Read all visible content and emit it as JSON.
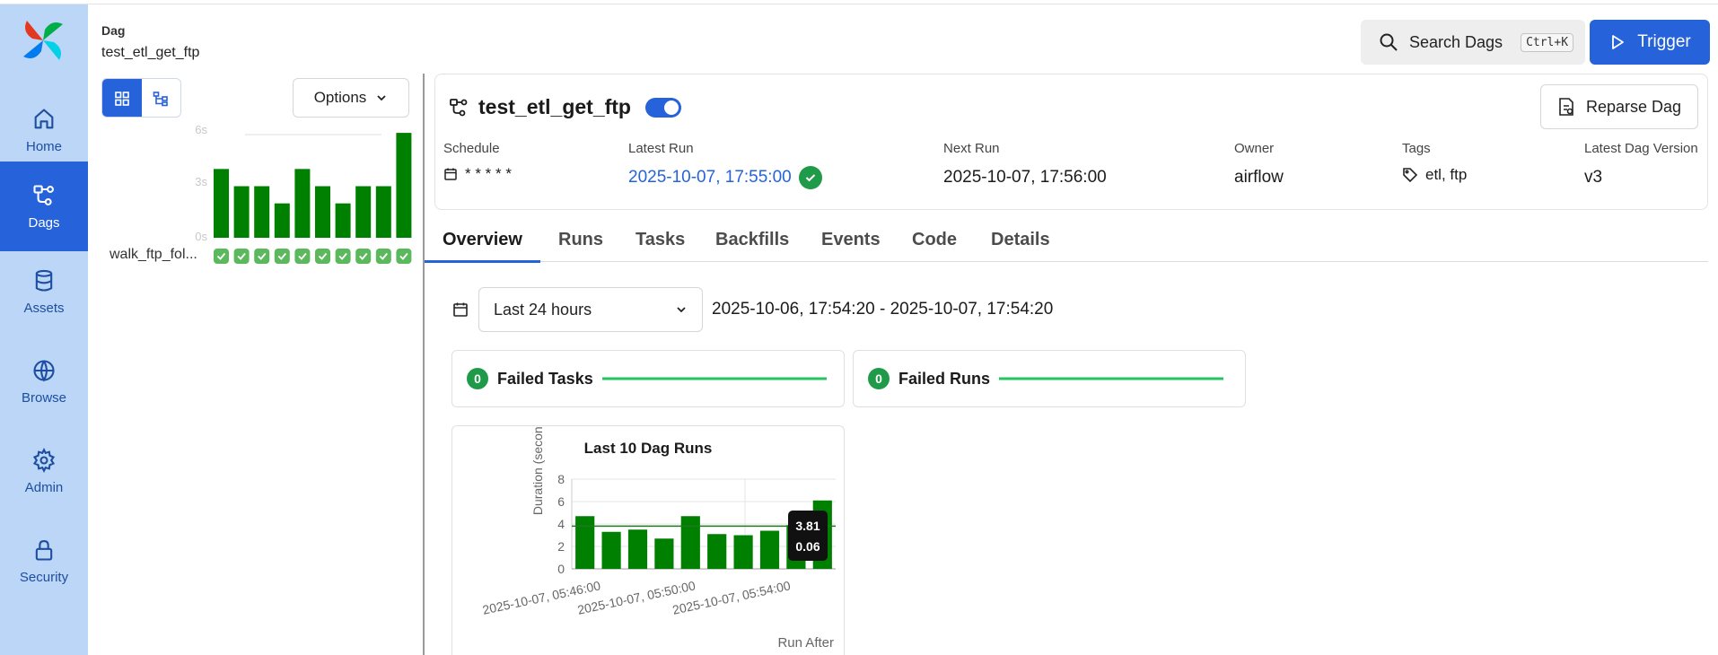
{
  "sidebar": {
    "items": [
      {
        "label": "Home",
        "icon": "home-icon"
      },
      {
        "label": "Dags",
        "icon": "dag-icon"
      },
      {
        "label": "Assets",
        "icon": "database-icon"
      },
      {
        "label": "Browse",
        "icon": "globe-icon"
      },
      {
        "label": "Admin",
        "icon": "gear-icon"
      },
      {
        "label": "Security",
        "icon": "lock-icon"
      }
    ],
    "active": "Dags"
  },
  "breadcrumb": {
    "label": "Dag",
    "name": "test_etl_get_ftp"
  },
  "left_panel": {
    "options_label": "Options",
    "task_name": "walk_ftp_fol...",
    "duration_ticks": [
      "6s",
      "3s",
      "0s"
    ],
    "run_durations": [
      4.0,
      3.0,
      3.0,
      2.0,
      4.0,
      3.0,
      2.0,
      3.0,
      3.0,
      6.1
    ],
    "duration_max": 6
  },
  "topbar": {
    "search_label": "Search Dags",
    "search_shortcut": "Ctrl+K",
    "trigger_label": "Trigger"
  },
  "header": {
    "title": "test_etl_get_ftp",
    "reparse_label": "Reparse Dag",
    "schedule_label": "Schedule",
    "schedule_value": "* * * * *",
    "latest_run_label": "Latest Run",
    "latest_run_value": "2025-10-07, 17:55:00",
    "next_run_label": "Next Run",
    "next_run_value": "2025-10-07, 17:56:00",
    "owner_label": "Owner",
    "owner_value": "airflow",
    "tags_label": "Tags",
    "tags_value": "etl, ftp",
    "version_label": "Latest Dag Version",
    "version_value": "v3"
  },
  "tabs": [
    "Overview",
    "Runs",
    "Tasks",
    "Backfills",
    "Events",
    "Code",
    "Details"
  ],
  "active_tab": "Overview",
  "filter": {
    "range_label": "Last 24 hours",
    "range_text": "2025-10-06, 17:54:20 - 2025-10-07, 17:54:20"
  },
  "stats": [
    {
      "count": "0",
      "label": "Failed Tasks"
    },
    {
      "count": "0",
      "label": "Failed Runs"
    }
  ],
  "colors": {
    "accent": "#2662d9",
    "success": "#1f9a48",
    "bar": "#008000",
    "sidebar_bg": "#bcd6f7"
  },
  "chart_data": {
    "type": "bar",
    "title": "Last 10 Dag Runs",
    "xlabel": "Run After",
    "ylabel": "Duration (seconds)",
    "ylim": [
      0,
      8
    ],
    "yticks": [
      0,
      2,
      4,
      6,
      8
    ],
    "x_tick_labels": [
      "2025-10-07, 05:46:00",
      "2025-10-07, 05:50:00",
      "2025-10-07, 05:54:00"
    ],
    "values": [
      4.7,
      3.3,
      3.5,
      2.7,
      4.7,
      3.1,
      3.0,
      3.4,
      3.9,
      6.1
    ],
    "mean_line": 3.81,
    "tooltip": [
      "3.81",
      "0.06"
    ],
    "grid": true
  }
}
